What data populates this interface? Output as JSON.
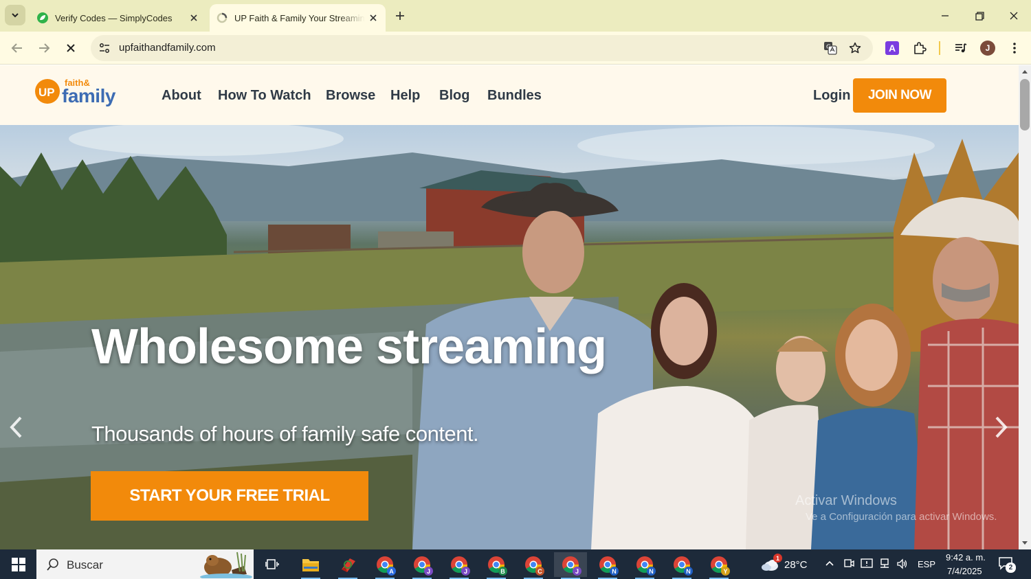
{
  "browser": {
    "tabs": [
      {
        "title": "Verify Codes — SimplyCodes",
        "active": false,
        "favicon": "simplycodes-leaf-icon"
      },
      {
        "title": "UP Faith & Family Your Streaming",
        "active": true,
        "favicon": "loading-spinner-icon"
      }
    ],
    "url": "upfaithandfamily.com",
    "profile_initial": "J",
    "extension_letter": "A"
  },
  "site": {
    "logo": {
      "up": "UP",
      "faith": "faith&",
      "family": "family"
    },
    "nav": [
      "About",
      "How To Watch",
      "Browse",
      "Help",
      "Blog",
      "Bundles"
    ],
    "login": "Login",
    "join": "JOIN NOW"
  },
  "hero": {
    "headline": "Wholesome streaming",
    "subline": "Thousands of hours of family safe content.",
    "cta": "START YOUR FREE TRIAL",
    "watermark_title": "Activar Windows",
    "watermark_sub": "Ve a Configuración para activar Windows."
  },
  "taskbar": {
    "search_placeholder": "Buscar",
    "chrome_profiles": [
      "A",
      "J",
      "J",
      "B",
      "C",
      "J",
      "N",
      "N",
      "N",
      "Y"
    ],
    "weather_temp": "28°C",
    "weather_badge": "1",
    "language": "ESP",
    "time": "9:42 a. m.",
    "date": "7/4/2025",
    "notifications": "2"
  },
  "colors": {
    "tabstrip": "#ececbf",
    "toolbar": "#fffbe3",
    "header_bg": "#fff9ec",
    "brand_orange": "#f28a0b",
    "nav_text": "#2f3a46",
    "taskbar": "#1d2a3a"
  }
}
